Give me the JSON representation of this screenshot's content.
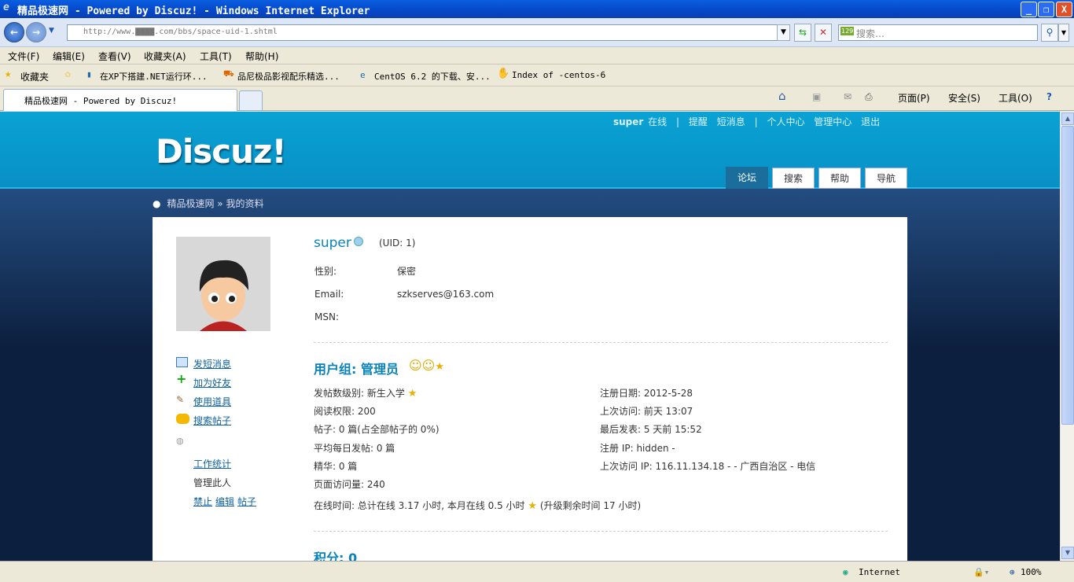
{
  "window": {
    "title": "精品极速网 - Powered by Discuz! - Windows Internet Explorer",
    "min": "_",
    "max": "❐",
    "close": "X"
  },
  "browser": {
    "url": "http://www.▇▇▇▇.com/bbs/space-uid-1.shtml",
    "search_placeholder": "搜索…",
    "search_badge": "129"
  },
  "menu": [
    "文件(F)",
    "编辑(E)",
    "查看(V)",
    "收藏夹(A)",
    "工具(T)",
    "帮助(H)"
  ],
  "favorites": {
    "label": "收藏夹",
    "items": [
      "在XP下搭建.NET运行环...",
      "品尼极品影视配乐精选...",
      "CentOS 6.2 的下载、安...",
      "Index of -centos-6"
    ]
  },
  "tab": {
    "title": "精品极速网 - Powered by Discuz!"
  },
  "commands": [
    "页面(P)",
    "安全(S)",
    "工具(O)"
  ],
  "site": {
    "logo": "Discuz!",
    "user": "super",
    "online": "在线",
    "links": [
      "提醒",
      "短消息",
      "个人中心",
      "管理中心",
      "退出"
    ],
    "sep": "|",
    "nav": [
      "论坛",
      "搜索",
      "帮助",
      "导航"
    ],
    "breadcrumb": "精品极速网 » 我的资料"
  },
  "profile": {
    "name": "super",
    "uid": "(UID: 1)",
    "fields": [
      {
        "label": "性别:",
        "value": "保密"
      },
      {
        "label": "Email:",
        "value": "szkserves@163.com"
      },
      {
        "label": "MSN:",
        "value": ""
      }
    ],
    "actions": [
      "发短消息",
      "加为好友",
      "使用道具",
      "搜索帖子"
    ],
    "admin": {
      "stats": "工作统计",
      "manage": "管理此人",
      "ops": [
        "禁止",
        "编辑",
        "帖子"
      ]
    },
    "group_title": "用户组: 管理员",
    "left_stats": [
      "发帖数级别: 新生入学",
      "阅读权限: 200",
      "帖子: 0 篇(占全部帖子的  0%)",
      "平均每日发帖: 0 篇",
      "精华: 0 篇",
      "页面访问量: 240"
    ],
    "right_stats": [
      "注册日期: 2012-5-28",
      "上次访问: 前天 13:07",
      "最后发表: 5 天前 15:52",
      "注册  IP: hidden -",
      "上次访问  IP: 116.11.134.18 - - 广西自治区  - 电信"
    ],
    "online_time": "在线时间: 总计在线  3.17 小时, 本月在线  0.5 小时",
    "upgrade": "(升级剩余时间  17 小时)",
    "points": "积分: 0"
  },
  "status": {
    "zone": "Internet",
    "zoom": "100%"
  }
}
